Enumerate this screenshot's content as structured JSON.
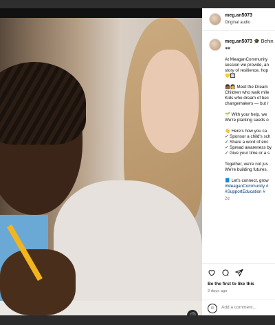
{
  "post": {
    "username": "meg.an5073",
    "audio": "Original audio"
  },
  "caption": {
    "username": "meg.an5073",
    "first_line": "🎓 Behin",
    "lines": [
      {
        "text": "🕶",
        "tag": false
      },
      {
        "text": "",
        "tag": false
      },
      {
        "text": "At MeaganCommunity",
        "tag": false
      },
      {
        "text": "session we provide, an",
        "tag": false
      },
      {
        "text": "story of resilience, hop",
        "tag": false
      },
      {
        "text": "💛🔲",
        "tag": false
      },
      {
        "text": "",
        "tag": false
      },
      {
        "text": "👩🏾👩 Meet the Dream",
        "tag": false
      },
      {
        "text": "Children who walk mile",
        "tag": false
      },
      {
        "text": "Kids who dream of bec",
        "tag": false
      },
      {
        "text": "changemakers — but r",
        "tag": false
      },
      {
        "text": "",
        "tag": false
      },
      {
        "text": "🌱 With your help, we",
        "tag": false
      },
      {
        "text": "We're planting seeds o",
        "tag": false
      },
      {
        "text": "",
        "tag": false
      },
      {
        "text": "👋 Here's how you ca",
        "tag": false
      },
      {
        "text": "✓ Sponsor a child's sch",
        "tag": false
      },
      {
        "text": "✓ Share a word of enc",
        "tag": false
      },
      {
        "text": "✓ Spread awareness by",
        "tag": false
      },
      {
        "text": "✓ Give your time or a s",
        "tag": false
      },
      {
        "text": "",
        "tag": false
      },
      {
        "text": "Together, we're not jus",
        "tag": false
      },
      {
        "text": "We're building futures.",
        "tag": false
      },
      {
        "text": "",
        "tag": false
      },
      {
        "text": "📘 Let's connect, grow",
        "tag": false
      },
      {
        "text": "#MeaganCommunity #",
        "tag": true
      },
      {
        "text": "#SupportEducation #",
        "tag": true
      }
    ],
    "age": "2d"
  },
  "actions": {
    "like_icon": "heart-icon",
    "comment_icon": "comment-icon",
    "share_icon": "share-icon"
  },
  "likes_text": "Be the first to like this",
  "time_ago": "2 days ago",
  "comment": {
    "emoji_icon": "smile-icon",
    "placeholder": "Add a comment..."
  }
}
